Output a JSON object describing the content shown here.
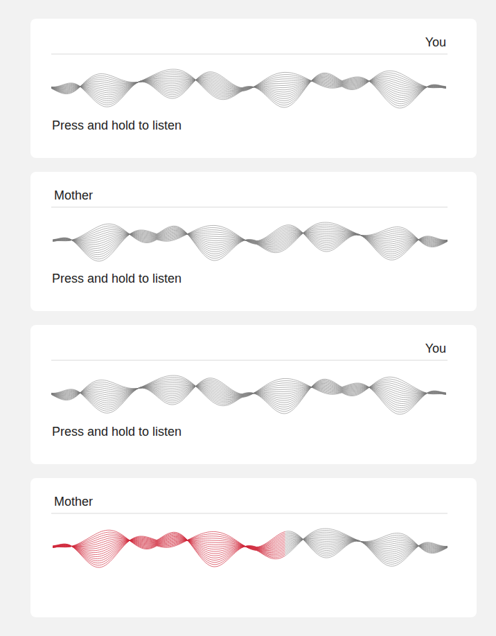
{
  "messages": [
    {
      "sender": "You",
      "from_self": true,
      "hint": "Press and hold to listen",
      "level": 0
    },
    {
      "sender": "Mother",
      "from_self": false,
      "hint": "Press and hold to listen",
      "level": 0
    },
    {
      "sender": "You",
      "from_self": true,
      "hint": "Press and hold to listen",
      "level": 0
    },
    {
      "sender": "Mother",
      "from_self": false,
      "level": 0.59
    }
  ]
}
